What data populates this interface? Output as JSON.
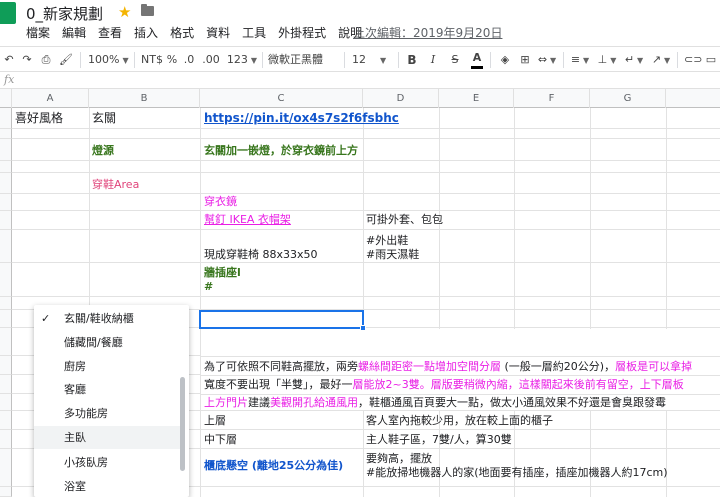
{
  "doc": {
    "title": "0_新家規劃",
    "last_edit": "上次編輯：2019年9月20日"
  },
  "menu": [
    "檔案",
    "編輯",
    "查看",
    "插入",
    "格式",
    "資料",
    "工具",
    "外掛程式",
    "說明"
  ],
  "toolbar": {
    "zoom": "100%",
    "currency": "NT$",
    "percent": "%",
    "decimal_less": ".0",
    "decimal_more": ".00",
    "format_more": "123",
    "font": "微軟正黑體",
    "font_size": "12",
    "bold": "B",
    "italic": "I",
    "strike": "S",
    "text_color": "A"
  },
  "columns": [
    "A",
    "B",
    "C",
    "D",
    "E",
    "F",
    "G"
  ],
  "cells": {
    "r1": {
      "a": "喜好風格",
      "b": "玄關",
      "c": "https://pin.it/ox4s7s2f6fsbhc"
    },
    "r3": {
      "b": "燈源",
      "c": "玄關加一嵌燈，於穿衣鏡前上方"
    },
    "r5": {
      "b": "穿鞋Area"
    },
    "r6": {
      "c": "穿衣鏡"
    },
    "r7": {
      "c": "幫釘 IKEA 衣帽架",
      "d": "可掛外套、包包"
    },
    "r8": {
      "c": "現成穿鞋椅 88x33x50",
      "d1": "#外出鞋",
      "d2": "#雨天濕鞋"
    },
    "r9": {
      "c1": "牆插座l",
      "c2": "#"
    },
    "r12": {
      "c_black1": "為了可依照不同鞋高擺放，兩旁",
      "c_pink": "螺絲間距密一點增加空間分層",
      "c_black2": " (一般一層約20公分)，",
      "c_pink2": "層板是可以拿掉"
    },
    "r13": {
      "c_black1": "寬度不要出現「半雙」，最好一",
      "c_pink": "層能放2~3雙。層版要稍微內縮，這樣關起來後前有留空，上下層板"
    },
    "r14": {
      "c_pink": "上方門片",
      "c_black": "建議",
      "c_pink2": "美觀開孔給通風用",
      "c_black2": "，鞋櫃通風百頁要大一點，做太小通風效果不好還是會臭跟發霉"
    },
    "r15": {
      "c": "上層",
      "d": "客人室內拖較少用，放在較上面的櫃子"
    },
    "r16": {
      "c": "中下層",
      "d": "主人鞋子區，7雙/人，算30雙"
    },
    "r17": {
      "c": "櫃底懸空 (離地25公分為佳)",
      "d1": "要夠高，擺放",
      "d2": "#能放掃地機器人的家(地面要有插座，插座加機器人約17cm)"
    }
  },
  "dropdown": {
    "items": [
      "玄關/鞋收納櫃",
      "儲藏間/餐廳",
      "廚房",
      "客廳",
      "多功能房",
      "主臥",
      "小孩臥房",
      "浴室"
    ],
    "checked_index": 0,
    "hover_index": 5
  },
  "colors": {
    "green_text": "#38761d",
    "pink_text": "#e0457b",
    "magenta_text": "#e91ee5",
    "link_blue": "#1155cc",
    "selection": "#1a73e8",
    "sheets_green": "#0f9d58"
  }
}
